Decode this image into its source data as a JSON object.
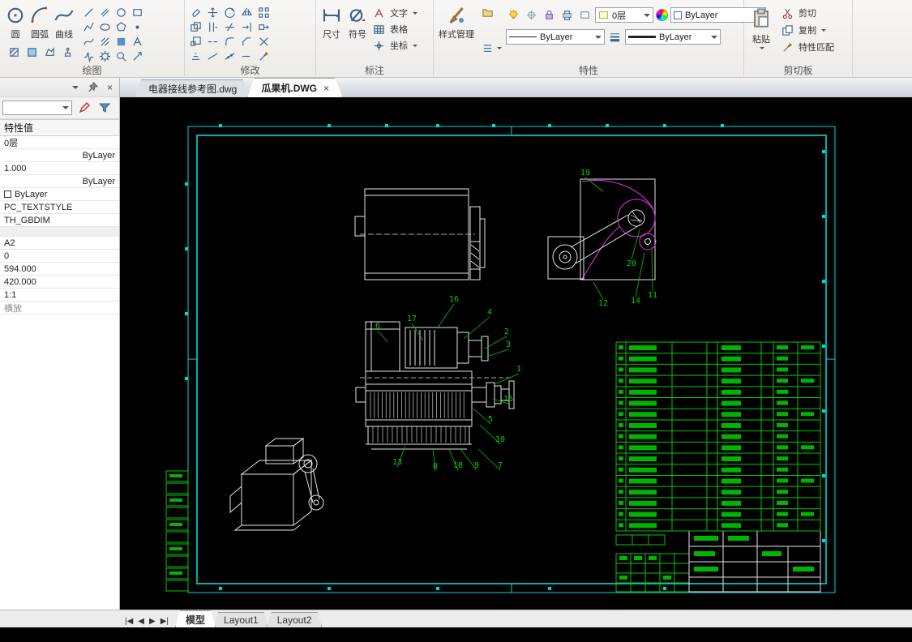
{
  "ui": {
    "close": "×"
  },
  "ribbon": {
    "draw": {
      "label": "绘图",
      "circle": "圆",
      "arc": "圆弧",
      "curve": "曲线"
    },
    "modify": {
      "label": "修改"
    },
    "annotate": {
      "label": "标注",
      "dimension": "尺寸",
      "symbol": "符号",
      "text": "文字",
      "table": "表格",
      "coord": "坐标"
    },
    "properties": {
      "label": "特性",
      "style_manager": "样式管理",
      "layer_value": "0层",
      "color_value": "ByLayer",
      "linetype_value": "ByLayer",
      "lineweight_value": "ByLayer"
    },
    "clipboard": {
      "label": "剪切板",
      "paste": "粘贴",
      "cut": "剪切",
      "copy": "复制",
      "match": "特性匹配"
    }
  },
  "doc_tabs": [
    {
      "label": "电器接线参考图.dwg",
      "active": false
    },
    {
      "label": "瓜果机.DWG",
      "active": true
    }
  ],
  "palette": {
    "header": "特性值",
    "rows": [
      {
        "text": "0层"
      },
      {
        "text": "ByLayer",
        "align": "right"
      },
      {
        "text": "1.000"
      },
      {
        "text": "ByLayer",
        "align": "right"
      },
      {
        "text": "ByLayer",
        "swatch": true
      },
      {
        "text": "PC_TEXTSTYLE"
      },
      {
        "text": "TH_GBDIM"
      },
      {
        "text": ""
      },
      {
        "text": "A2"
      },
      {
        "text": "0"
      },
      {
        "text": "594.000"
      },
      {
        "text": "420.000"
      },
      {
        "text": "1:1"
      },
      {
        "text": "横放",
        "muted": true
      }
    ]
  },
  "model_nav": {
    "first": "|◀",
    "prev": "◀",
    "next": "▶",
    "last": "▶|"
  },
  "model_tabs": [
    {
      "label": "模型",
      "active": true
    },
    {
      "label": "Layout1",
      "active": false
    },
    {
      "label": "Layout2",
      "active": false
    }
  ],
  "canvas": {
    "callouts": [
      "16",
      "4",
      "17",
      "6",
      "2",
      "3",
      "1",
      "15",
      "5",
      "10",
      "13",
      "8",
      "18",
      "9",
      "7",
      "19",
      "20",
      "12",
      "14",
      "11"
    ],
    "bom_rows": 17,
    "colors": {
      "frame": "#00d8d8",
      "lines": "#e4e4e4",
      "detail": "#f02bf0",
      "annot": "#00c800"
    }
  }
}
